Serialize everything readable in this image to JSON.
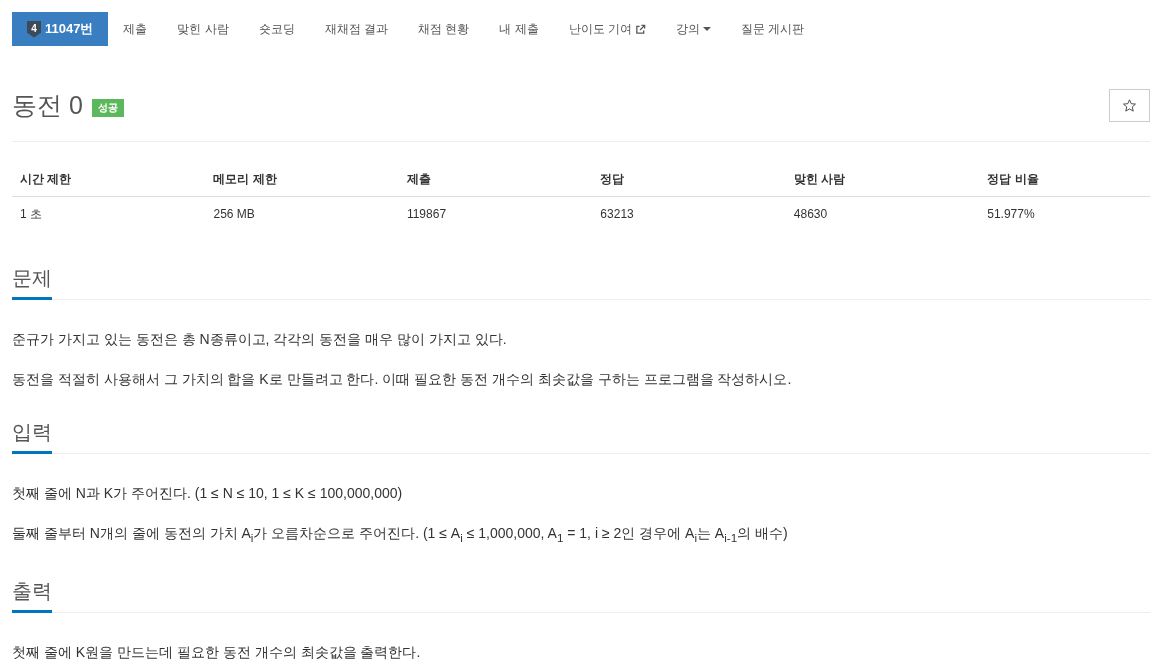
{
  "nav": {
    "tabs": [
      {
        "label": "11047번",
        "kind": "problem",
        "tier": "4",
        "selected": true
      },
      {
        "label": "제출",
        "kind": "link",
        "selected": false
      },
      {
        "label": "맞힌 사람",
        "kind": "link",
        "selected": false
      },
      {
        "label": "숏코딩",
        "kind": "link",
        "selected": false
      },
      {
        "label": "재채점 결과",
        "kind": "link",
        "selected": false
      },
      {
        "label": "채점 현황",
        "kind": "link",
        "selected": false
      },
      {
        "label": "내 제출",
        "kind": "link",
        "selected": false
      },
      {
        "label": "난이도 기여",
        "kind": "external",
        "selected": false
      },
      {
        "label": "강의",
        "kind": "dropdown",
        "selected": false
      },
      {
        "label": "질문 게시판",
        "kind": "link",
        "selected": false
      }
    ]
  },
  "problem": {
    "title": "동전 0",
    "status_badge": "성공",
    "starred": false
  },
  "info_table": {
    "columns": [
      "시간 제한",
      "메모리 제한",
      "제출",
      "정답",
      "맞힌 사람",
      "정답 비율"
    ],
    "rows": [
      [
        "1 초",
        "256 MB",
        "119867",
        "63213",
        "48630",
        "51.977%"
      ]
    ]
  },
  "sections": [
    {
      "heading": "문제",
      "paragraphs": [
        "준규가 가지고 있는 동전은 총 N종류이고, 각각의 동전을 매우 많이 가지고 있다.",
        "동전을 적절히 사용해서 그 가치의 합을 K로 만들려고 한다. 이때 필요한 동전 개수의 최솟값을 구하는 프로그램을 작성하시오."
      ]
    },
    {
      "heading": "입력",
      "paragraphs": [
        "첫째 줄에 N과 K가 주어진다. (1 ≤ N ≤ 10, 1 ≤ K ≤ 100,000,000)",
        "둘째 줄부터 N개의 줄에 동전의 가치 A$_{i}$가 오름차순으로 주어진다. (1 ≤ A$_{i}$ ≤ 1,000,000, A$_{1}$ = 1, i ≥ 2인 경우에 A$_{i}$는 A$_{i-1}$의 배수)"
      ]
    },
    {
      "heading": "출력",
      "paragraphs": [
        "첫째 줄에 K원을 만드는데 필요한 동전 개수의 최솟값을 출력한다."
      ]
    }
  ]
}
